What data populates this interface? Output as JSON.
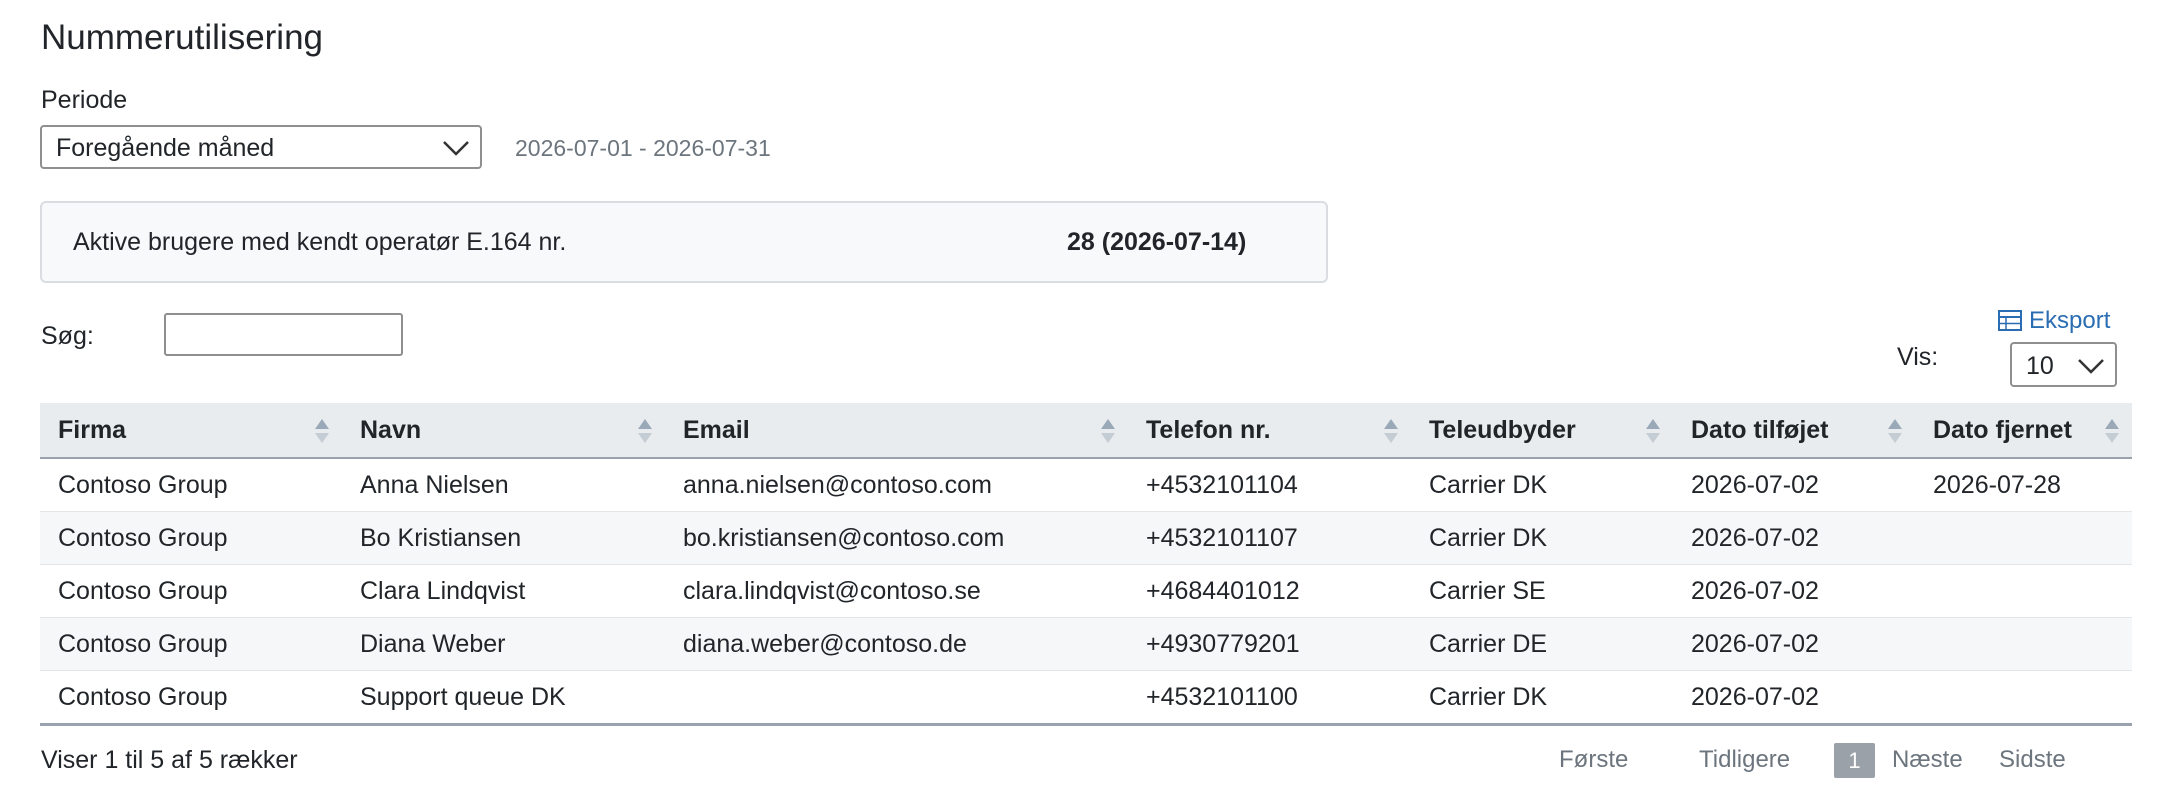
{
  "page": {
    "title": "Nummerutilisering"
  },
  "period": {
    "label": "Periode",
    "selected": "Foregående måned",
    "range": "2026-07-01 - 2026-07-31"
  },
  "summary": {
    "label": "Aktive brugere med kendt operatør E.164 nr.",
    "value": "28 (2026-07-14)"
  },
  "search": {
    "label": "Søg:",
    "value": ""
  },
  "export": {
    "label": "Eksport",
    "icon": "table-icon"
  },
  "page_size": {
    "label": "Vis:",
    "value": "10"
  },
  "table": {
    "columns": [
      "Firma",
      "Navn",
      "Email",
      "Telefon nr.",
      "Teleudbyder",
      "Dato tilføjet",
      "Dato fjernet"
    ],
    "rows": [
      [
        "Contoso Group",
        "Anna Nielsen",
        "anna.nielsen@contoso.com",
        "+4532101104",
        "Carrier DK",
        "2026-07-02",
        "2026-07-28"
      ],
      [
        "Contoso Group",
        "Bo Kristiansen",
        "bo.kristiansen@contoso.com",
        "+4532101107",
        "Carrier DK",
        "2026-07-02",
        ""
      ],
      [
        "Contoso Group",
        "Clara Lindqvist",
        "clara.lindqvist@contoso.se",
        "+4684401012",
        "Carrier SE",
        "2026-07-02",
        ""
      ],
      [
        "Contoso Group",
        "Diana Weber",
        "diana.weber@contoso.de",
        "+4930779201",
        "Carrier DE",
        "2026-07-02",
        ""
      ],
      [
        "Contoso Group",
        "Support queue DK",
        "",
        "+4532101100",
        "Carrier DK",
        "2026-07-02",
        ""
      ]
    ]
  },
  "footer": {
    "info": "Viser 1 til 5 af 5 rækker",
    "first": "Første",
    "previous": "Tidligere",
    "current_page": "1",
    "next": "Næste",
    "last": "Sidste"
  },
  "colors": {
    "link": "#2a6db3",
    "header_bg": "#e9ecef",
    "current_page_bg": "#9aa1a8"
  }
}
